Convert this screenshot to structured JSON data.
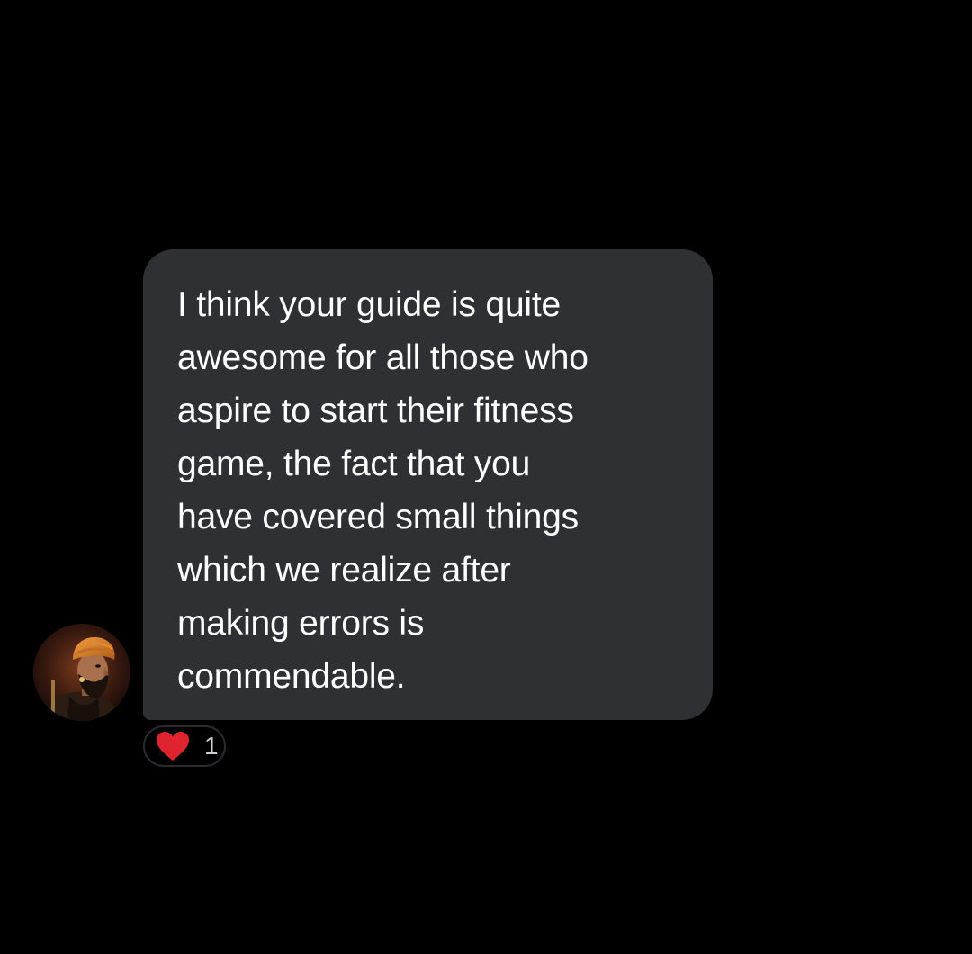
{
  "chat": {
    "messages": [
      {
        "sender": "other",
        "avatar_icon": "portrait-avatar-icon",
        "text": "I think your guide is quite\nawesome for all those who\naspire to start their fitness\ngame, the fact that you\nhave covered small things\nwhich we realize after\nmaking errors is\ncommendable.",
        "reaction": {
          "icon": "heart-icon",
          "count": "1"
        }
      }
    ]
  },
  "colors": {
    "background": "#000000",
    "bubble": "#2f3033",
    "text": "#ffffff",
    "heart": "#e0242f",
    "reaction_count": "#d0d0d0"
  }
}
